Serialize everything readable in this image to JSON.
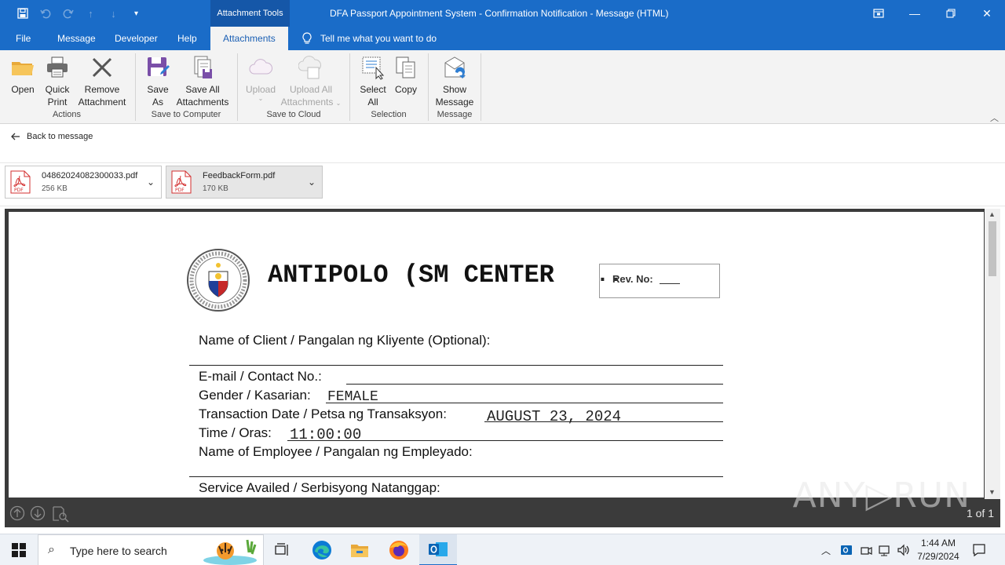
{
  "window": {
    "title": "DFA Passport Appointment System - Confirmation Notification  -  Message (HTML)",
    "context_tab_group": "Attachment Tools"
  },
  "quick_access": [
    {
      "icon": "save-icon"
    },
    {
      "icon": "undo-icon"
    },
    {
      "icon": "redo-icon"
    },
    {
      "icon": "up-arrow-icon"
    },
    {
      "icon": "down-arrow-icon"
    },
    {
      "icon": "customize-qat-icon"
    }
  ],
  "tabs": [
    "File",
    "Message",
    "Developer",
    "Help",
    "Attachments"
  ],
  "active_tab": "Attachments",
  "tell_me": "Tell me what you want to do",
  "ribbon": {
    "open": "Open",
    "quick_print": [
      "Quick",
      "Print"
    ],
    "remove_attachment": [
      "Remove",
      "Attachment"
    ],
    "group_actions": "Actions",
    "save_as": [
      "Save",
      "As"
    ],
    "save_all_attachments": [
      "Save All",
      "Attachments"
    ],
    "group_save_computer": "Save to Computer",
    "upload": "Upload",
    "upload_all": [
      "Upload All",
      "Attachments"
    ],
    "group_save_cloud": "Save to Cloud",
    "select_all": [
      "Select",
      "All"
    ],
    "copy": "Copy",
    "group_selection": "Selection",
    "show_message": [
      "Show",
      "Message"
    ],
    "group_message": "Message"
  },
  "back_link": "Back to message",
  "attachments": [
    {
      "name": "04862024082300033.pdf",
      "size": "256 KB",
      "selected": false
    },
    {
      "name": "FeedbackForm.pdf",
      "size": "170 KB",
      "selected": true
    }
  ],
  "form": {
    "office": "ANTIPOLO (SM CENTER",
    "rev_no_label": "Rev. No:",
    "client_label": "Name of Client / Pangalan ng Kliyente (Optional):",
    "email_label": "E-mail / Contact No.:",
    "gender_label": "Gender / Kasarian:",
    "gender_value": "FEMALE",
    "date_label": "Transaction Date / Petsa ng Transaksyon:",
    "date_value": "AUGUST 23, 2024",
    "time_label": "Time / Oras:",
    "time_value": "11:00:00",
    "employee_label": "Name of Employee / Pangalan ng Empleyado:",
    "service_label": "Service Availed / Serbisyong Natanggap:"
  },
  "preview": {
    "page_info": "1 of 1",
    "watermark": "ANY▷RUN"
  },
  "taskbar": {
    "search_placeholder": "Type here to search",
    "time": "1:44 AM",
    "date": "7/29/2024"
  },
  "colors": {
    "accent": "#1a6cc8",
    "ribbon_bg": "#f3f3f3",
    "pdf_red": "#d32f2f"
  }
}
